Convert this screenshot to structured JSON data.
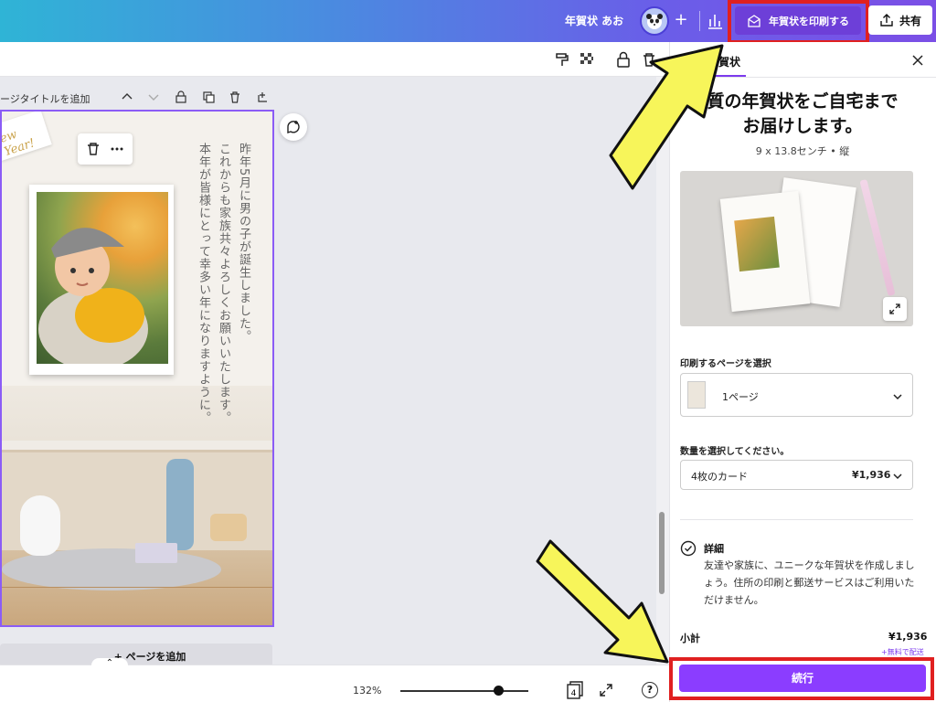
{
  "topbar": {
    "doc_name": "年賀状 あお",
    "plus": "+",
    "print_label": "年賀状を印刷する",
    "share_label": "共有"
  },
  "canvas": {
    "page_title": "ージタイトルを追加",
    "new_year_text": "ew Year!",
    "vertical_lines": [
      "昨年5月に男の子が誕生しました。",
      "これからも家族共々よろしくお願いいたします。",
      "本年が皆様にとって幸多い年になりますように。"
    ],
    "add_page": "+ ページを追加"
  },
  "bottombar": {
    "zoom": "132%",
    "page_count": "4",
    "help": "?"
  },
  "panel": {
    "tab_label": "賀状",
    "heading": "質の年賀状をご自宅まで\nお届けします。",
    "size_text": "9 x 13.8センチ • 縦",
    "page_select_label": "印刷するページを選択",
    "page_select_value": "1ページ",
    "qty_label": "数量を選択してください。",
    "qty_value": "4枚のカード",
    "qty_price": "¥1,936",
    "detail_title": "詳細",
    "detail_text": "友達や家族に、ユニークな年賀状を作成しましょう。住所の印刷と郵送サービスはご利用いただけません。",
    "subtotal_label": "小計",
    "subtotal_value": "¥1,936",
    "free_shipping": "+無料で配送",
    "continue_label": "続行"
  },
  "colors": {
    "accent": "#8b3dff",
    "highlight_red": "#e02020",
    "arrow_yellow": "#f7f55a"
  }
}
